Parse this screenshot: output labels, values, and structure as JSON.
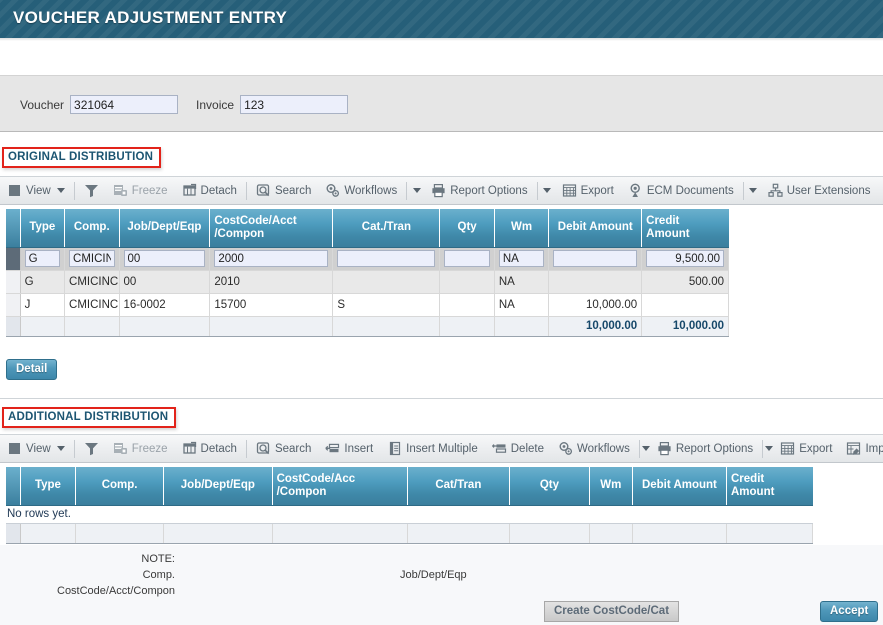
{
  "header": {
    "title": "VOUCHER ADJUSTMENT ENTRY"
  },
  "form": {
    "voucher_label": "Voucher",
    "voucher_value": "321064",
    "invoice_label": "Invoice",
    "invoice_value": "123"
  },
  "sections": {
    "original_label": "ORIGINAL DISTRIBUTION",
    "additional_label": "ADDITIONAL DISTRIBUTION"
  },
  "toolbar_original": {
    "items": [
      {
        "label": "View",
        "icon": "view-menu-icon",
        "caret": true,
        "dim": false
      },
      {
        "sep": true
      },
      {
        "label": "",
        "icon": "filter-icon",
        "dim": false
      },
      {
        "label": "Freeze",
        "icon": "freeze-icon",
        "dim": true
      },
      {
        "label": "Detach",
        "icon": "detach-icon",
        "dim": false
      },
      {
        "sep": true
      },
      {
        "label": "Search",
        "icon": "search-icon",
        "dim": false
      },
      {
        "label": "Workflows",
        "icon": "workflows-icon",
        "dim": false
      },
      {
        "sep": true
      },
      {
        "caret_only": true
      },
      {
        "label": "Report Options",
        "icon": "printer-icon",
        "dim": false
      },
      {
        "sep": true
      },
      {
        "caret_only": true
      },
      {
        "label": "Export",
        "icon": "export-icon",
        "dim": false
      },
      {
        "label": "ECM Documents",
        "icon": "ecm-documents-icon",
        "dim": false
      },
      {
        "sep": true
      },
      {
        "caret_only": true
      },
      {
        "label": "User Extensions",
        "icon": "user-extensions-icon",
        "dim": false
      }
    ]
  },
  "toolbar_additional": {
    "items": [
      {
        "label": "View",
        "icon": "view-menu-icon",
        "caret": true,
        "dim": false
      },
      {
        "sep": true
      },
      {
        "label": "",
        "icon": "filter-icon",
        "dim": false
      },
      {
        "label": "Freeze",
        "icon": "freeze-icon",
        "dim": true
      },
      {
        "label": "Detach",
        "icon": "detach-icon",
        "dim": false
      },
      {
        "sep": true
      },
      {
        "label": "Search",
        "icon": "search-icon",
        "dim": false
      },
      {
        "label": "Insert",
        "icon": "insert-icon",
        "dim": false
      },
      {
        "label": "Insert Multiple",
        "icon": "insert-multiple-icon",
        "dim": false
      },
      {
        "label": "Delete",
        "icon": "delete-icon",
        "dim": false
      },
      {
        "label": "Workflows",
        "icon": "workflows-icon",
        "dim": false
      },
      {
        "sep": true
      },
      {
        "caret_only": true
      },
      {
        "label": "Report Options",
        "icon": "printer-icon",
        "dim": false
      },
      {
        "sep": true
      },
      {
        "caret_only": true
      },
      {
        "label": "Export",
        "icon": "export-icon",
        "dim": false
      },
      {
        "label": "Impor",
        "icon": "import-icon",
        "dim": false
      }
    ]
  },
  "grid_original": {
    "columns": [
      "Type",
      "Comp.",
      "Job/Dept/Eqp",
      "CostCode/Acct\n/Compon",
      "Cat./Tran",
      "Qty",
      "Wm",
      "Debit Amount",
      "Credit\nAmount"
    ],
    "rows": [
      {
        "state": "selected",
        "type": "G",
        "comp": "CMICINC",
        "job": "00",
        "costcode": "2000",
        "cat": "",
        "qty": "",
        "wm": "NA",
        "debit": "",
        "credit": "9,500.00"
      },
      {
        "state": "alt",
        "type": "G",
        "comp": "CMICINC",
        "job": "00",
        "costcode": "2010",
        "cat": "",
        "qty": "",
        "wm": "NA",
        "debit": "",
        "credit": "500.00"
      },
      {
        "state": "plain",
        "type": "J",
        "comp": "CMICINC",
        "job": "16-0002",
        "costcode": "15700",
        "cat": "S",
        "qty": "",
        "wm": "NA",
        "debit": "10,000.00",
        "credit": ""
      }
    ],
    "totals": {
      "debit": "10,000.00",
      "credit": "10,000.00"
    }
  },
  "grid_additional": {
    "columns": [
      "Type",
      "Comp.",
      "Job/Dept/Eqp",
      "CostCode/Acc\n/Compon",
      "Cat/Tran",
      "Qty",
      "Wm",
      "Debit Amount",
      "Credit\nAmount"
    ],
    "empty_message": "No rows yet."
  },
  "buttons": {
    "detail": "Detail",
    "create_costcode": "Create CostCode/Cat",
    "accept": "Accept"
  },
  "note": {
    "line1": "NOTE:",
    "line2": "Comp.",
    "line3": "CostCode/Acct/Compon",
    "right": "Job/Dept/Eqp"
  },
  "colors": {
    "banner": "#265f79",
    "header_accent": "#4e9dbf",
    "section_outline": "#e2231a",
    "section_text": "#1c5572",
    "input_bg": "#eceffb",
    "total_text": "#16486a"
  }
}
